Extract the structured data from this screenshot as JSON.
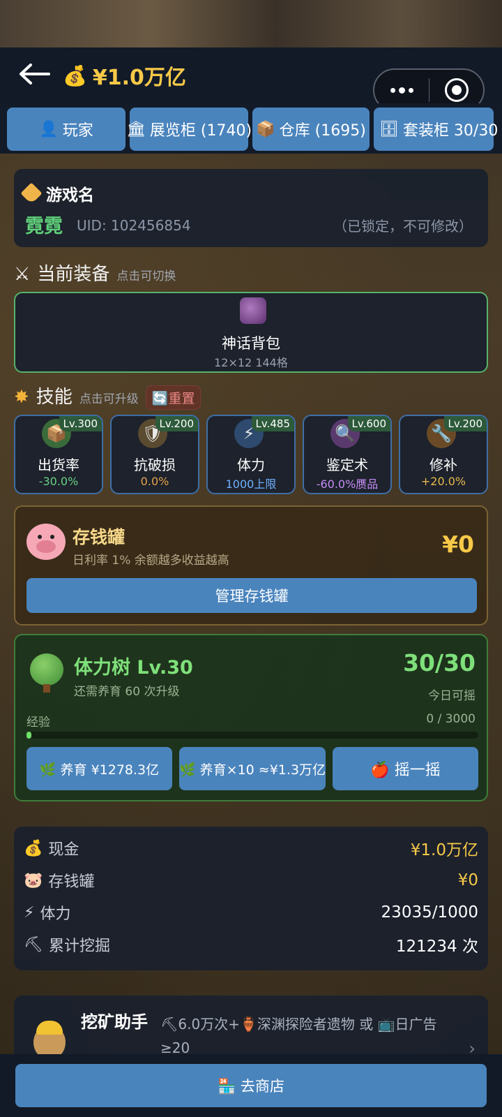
{
  "header": {
    "money": "¥1.0万亿"
  },
  "tabs": [
    {
      "icon": "👤",
      "label": "玩家"
    },
    {
      "icon": "🏛",
      "label": "展览柜 (1740)"
    },
    {
      "icon": "📦",
      "label": "仓库 (1695)"
    },
    {
      "icon": "🗄",
      "label": "套装柜 30/30"
    }
  ],
  "profile": {
    "section": "游戏名",
    "nickname": "霓霓",
    "uid": "UID: 102456854",
    "lock_note": "（已锁定，不可修改）"
  },
  "equipment": {
    "title": "当前装备",
    "hint": "点击可切换",
    "item_name": "神话背包",
    "item_desc": "12×12 144格"
  },
  "skills_section": {
    "title": "技能",
    "hint": "点击可升级",
    "reset": "🔄重置"
  },
  "skills": [
    {
      "level": "Lv.300",
      "name": "出货率",
      "value": "-30.0%",
      "color": "#69d184",
      "icon": "📦",
      "icon_bg": "#3a6b3a"
    },
    {
      "level": "Lv.200",
      "name": "抗破损",
      "value": "0.0%",
      "color": "#e8a24a",
      "icon": "🛡",
      "icon_bg": "#5a4a30"
    },
    {
      "level": "Lv.485",
      "name": "体力",
      "value": "1000上限",
      "color": "#6fb0ff",
      "icon": "⚡",
      "icon_bg": "#2e4a6e"
    },
    {
      "level": "Lv.600",
      "name": "鉴定术",
      "value": "-60.0%赝品",
      "color": "#c48cf5",
      "icon": "🔍",
      "icon_bg": "#5a3a6e"
    },
    {
      "level": "Lv.200",
      "name": "修补",
      "value": "+20.0%",
      "color": "#e8b84a",
      "icon": "🔧",
      "icon_bg": "#6a4a26"
    }
  ],
  "piggy": {
    "title": "存钱罐",
    "subtitle": "日利率 1%  余额越多收益越高",
    "amount": "¥0",
    "button": "管理存钱罐"
  },
  "tree": {
    "title": "体力树  Lv.30",
    "subtitle": "还需养育 60 次升级",
    "count": "30/30",
    "today": "今日可摇",
    "exp_label": "经验",
    "exp_value": "0 / 3000",
    "exp_fraction": 0.0,
    "btn_nurture": "🌿 养育 ¥1278.3亿",
    "btn_nurture10": "🌿 养育×10 ≈¥1.3万亿",
    "btn_shake": "🍎 摇一摇"
  },
  "stats": [
    {
      "icon": "💰",
      "label": "现金",
      "value": "¥1.0万亿",
      "gold": true
    },
    {
      "icon": "🐷",
      "label": "存钱罐",
      "value": "¥0",
      "gold": true
    },
    {
      "icon": "⚡",
      "label": "体力",
      "value": "23035/1000",
      "gold": false
    },
    {
      "icon": "⛏",
      "label": "累计挖掘",
      "value": "121234 次",
      "gold": false
    }
  ],
  "helper": {
    "title": "挖矿助手",
    "desc": "⛏6.0万次+🏺深渊探险者遗物 或 📺日广告≥20"
  },
  "shop": {
    "label": "🏪 去商店"
  }
}
